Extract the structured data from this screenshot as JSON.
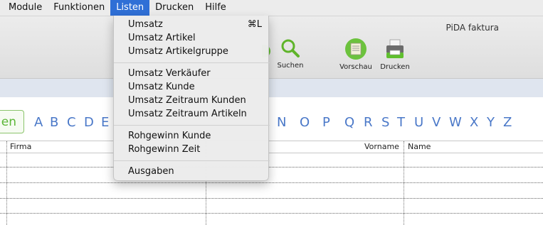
{
  "menubar": {
    "items": [
      "Module",
      "Funktionen",
      "Listen",
      "Drucken",
      "Hilfe"
    ],
    "active": "Listen"
  },
  "app": {
    "title": "PiDA faktura"
  },
  "toolbar": {
    "search_label": "Suchen",
    "preview_label": "Vorschau",
    "print_label": "Drucken"
  },
  "alphabet": {
    "button_text": "en",
    "letters_left": [
      "A",
      "B",
      "C",
      "D",
      "E"
    ],
    "letters_right": [
      "N",
      "O",
      "P",
      "Q",
      "R",
      "S",
      "T",
      "U",
      "V",
      "W",
      "X",
      "Y",
      "Z"
    ]
  },
  "table": {
    "columns": [
      "Firma",
      "Vorname",
      "Name"
    ]
  },
  "listen_menu": {
    "group1": [
      {
        "label": "Umsatz",
        "shortcut": "⌘L"
      },
      {
        "label": "Umsatz Artikel"
      },
      {
        "label": "Umsatz Artikelgruppe"
      }
    ],
    "group2": [
      {
        "label": "Umsatz Verkäufer"
      },
      {
        "label": "Umsatz Kunde"
      },
      {
        "label": "Umsatz Zeitraum Kunden"
      },
      {
        "label": "Umsatz Zeitraum Artikeln"
      }
    ],
    "group3": [
      {
        "label": "Rohgewinn Kunde"
      },
      {
        "label": "Rohgewinn Zeit"
      }
    ],
    "group4": [
      {
        "label": "Ausgaben"
      }
    ]
  }
}
